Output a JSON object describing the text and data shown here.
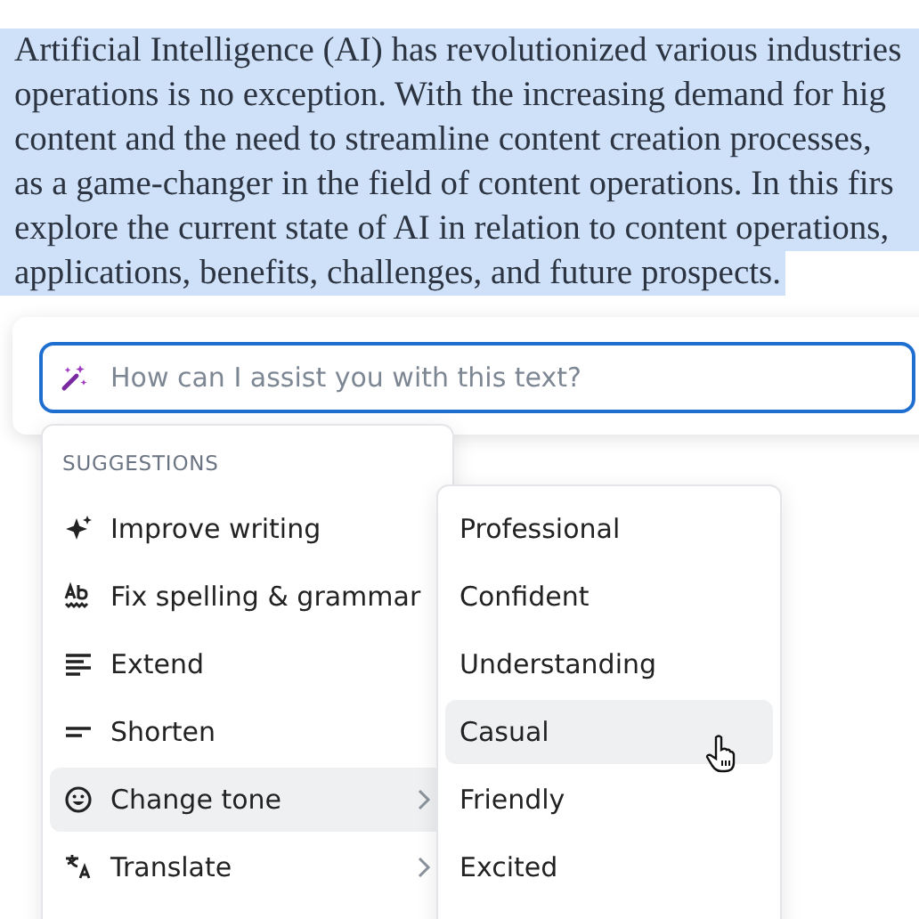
{
  "document": {
    "selected_lines": [
      "Artificial Intelligence (AI) has revolutionized various industries",
      "operations is no exception. With the increasing demand for hig",
      "content and the need to streamline content creation processes,",
      "as a game-changer in the field of content operations. In this firs",
      "explore the current state of AI in relation to content operations,",
      "applications, benefits, challenges, and future prospects."
    ]
  },
  "prompt": {
    "placeholder": "How can I assist you with this text?"
  },
  "suggestions": {
    "heading": "SUGGESTIONS",
    "items": [
      {
        "label": "Improve writing",
        "selected": false,
        "submenu": false
      },
      {
        "label": "Fix spelling & grammar",
        "selected": false,
        "submenu": false
      },
      {
        "label": "Extend",
        "selected": false,
        "submenu": false
      },
      {
        "label": "Shorten",
        "selected": false,
        "submenu": false
      },
      {
        "label": "Change tone",
        "selected": true,
        "submenu": true
      },
      {
        "label": "Translate",
        "selected": false,
        "submenu": true
      }
    ]
  },
  "tone_menu": {
    "items": [
      {
        "label": "Professional",
        "selected": false
      },
      {
        "label": "Confident",
        "selected": false
      },
      {
        "label": "Understanding",
        "selected": false
      },
      {
        "label": "Casual",
        "selected": true
      },
      {
        "label": "Friendly",
        "selected": false
      },
      {
        "label": "Excited",
        "selected": false
      }
    ]
  }
}
